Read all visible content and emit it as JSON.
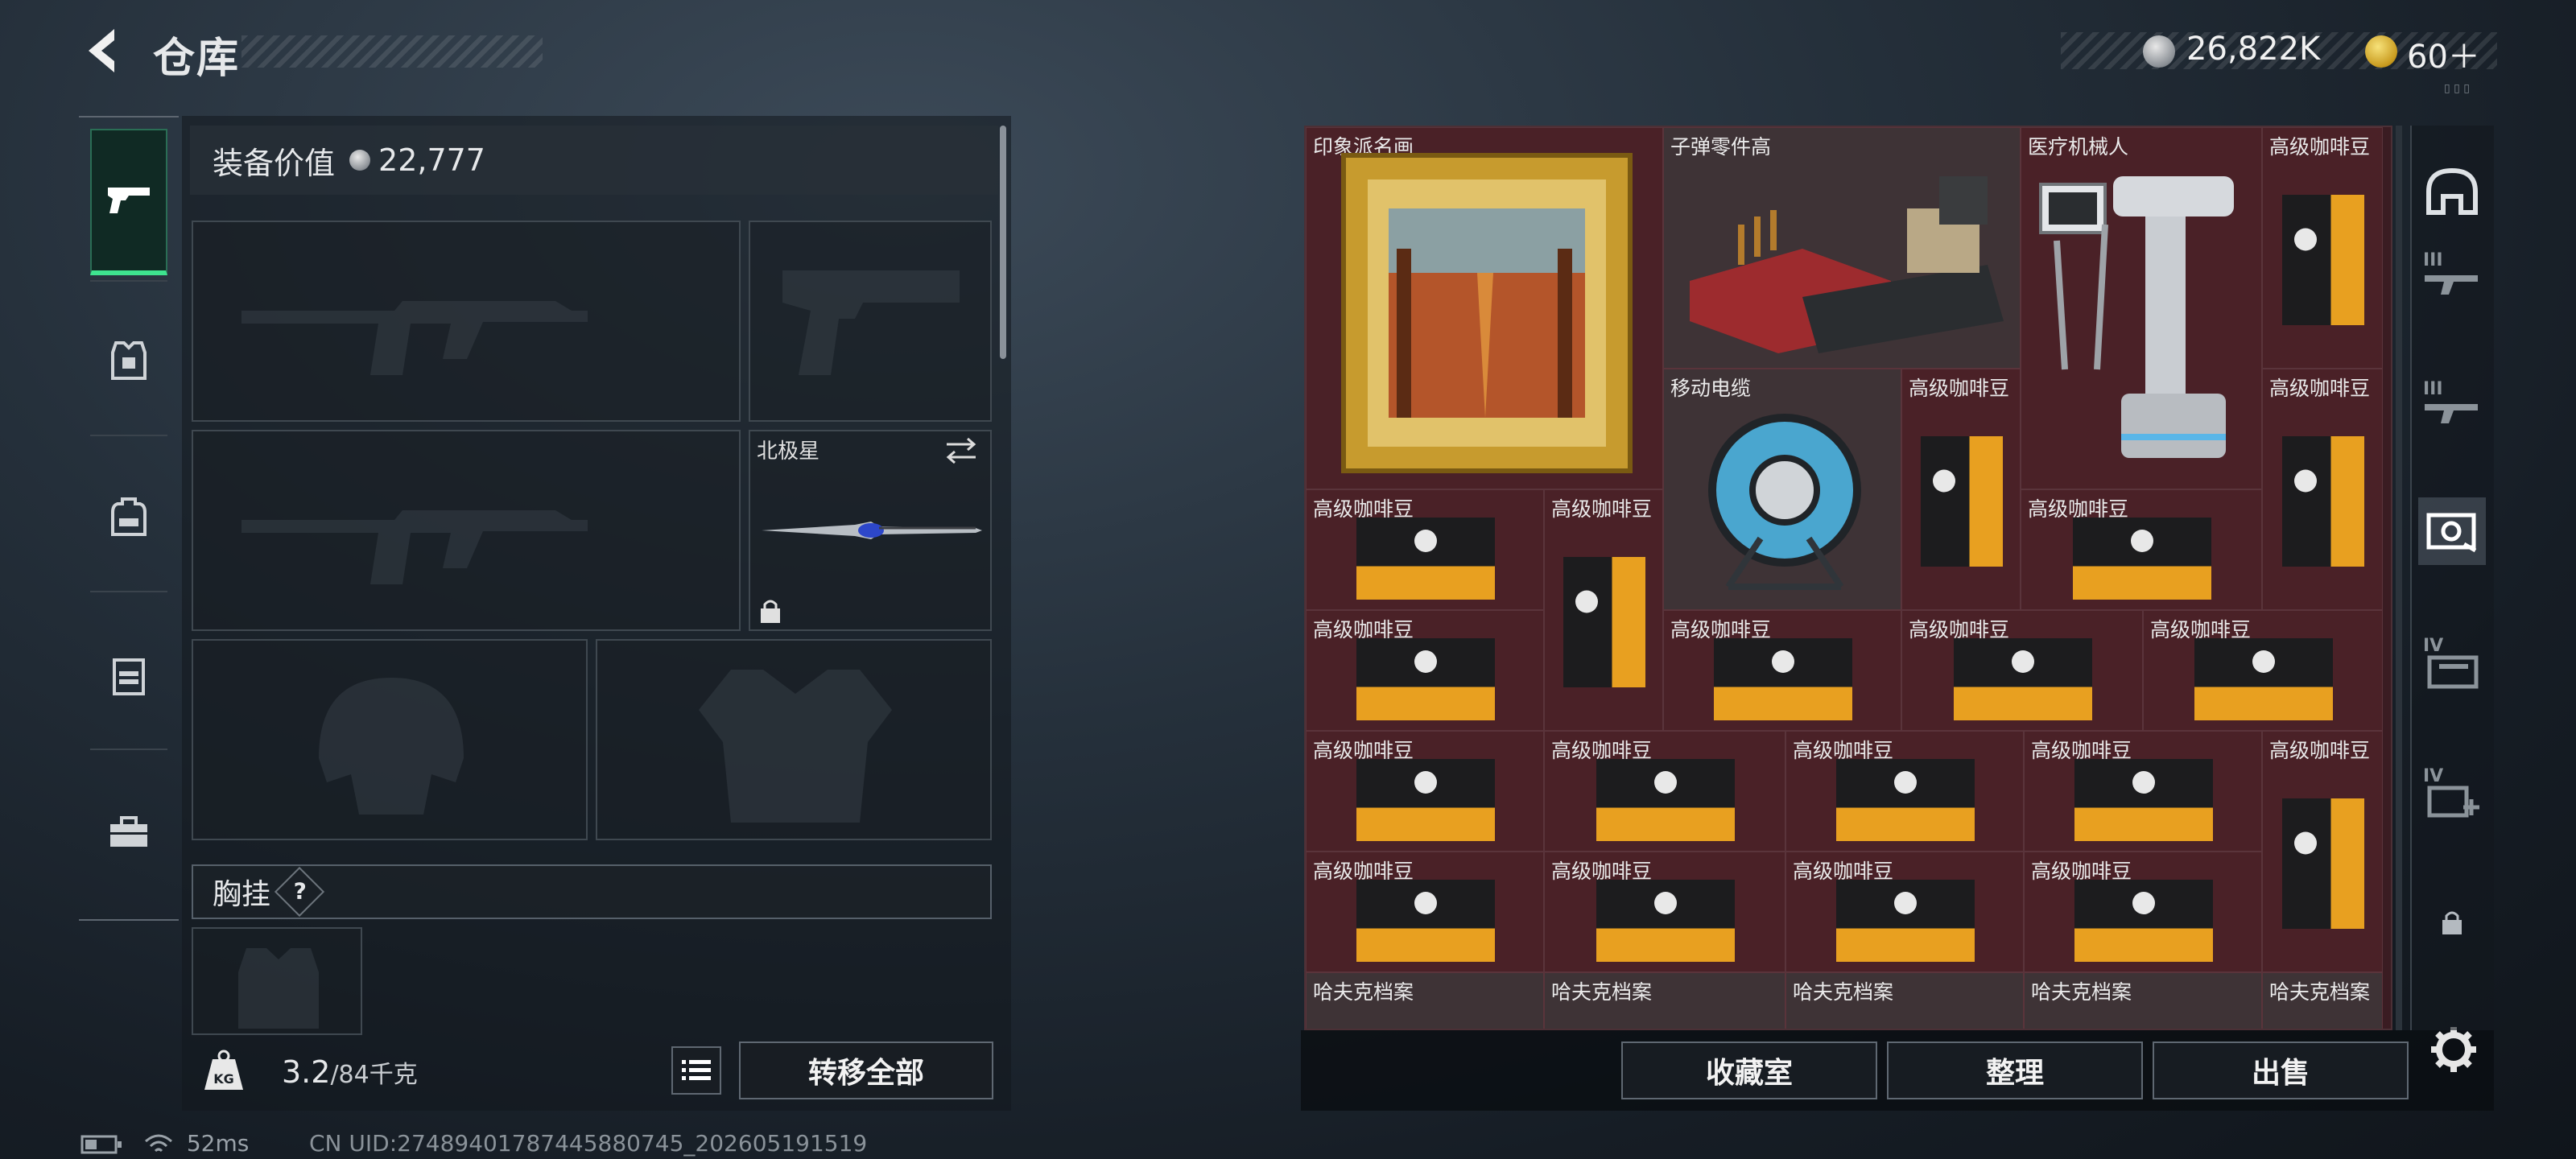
{
  "header": {
    "title": "仓库",
    "back_icon": "back-arrow-icon"
  },
  "currency": {
    "silver": "26,822K",
    "gold": "60＋"
  },
  "sidebar": {
    "items": [
      {
        "name": "pistol-icon",
        "active": true
      },
      {
        "name": "armor-vest-icon",
        "active": false
      },
      {
        "name": "backpack-icon",
        "active": false
      },
      {
        "name": "chest-rig-icon",
        "active": false
      },
      {
        "name": "toolbox-icon",
        "active": false
      }
    ]
  },
  "equipment": {
    "value_label": "装备价值",
    "value": "22,777",
    "melee_name": "北极星",
    "chest_label": "胸挂",
    "chest_help": "?",
    "weight": "3.2",
    "weight_capacity": "/84千克",
    "transfer_all": "转移全部"
  },
  "stash": {
    "items": [
      {
        "label": "印象派名画"
      },
      {
        "label": "子弹零件高"
      },
      {
        "label": "医疗机械人"
      },
      {
        "label": "高级咖啡豆"
      },
      {
        "label": "移动电缆"
      },
      {
        "label": "高级咖啡豆"
      },
      {
        "label": "高级咖啡豆"
      },
      {
        "label": "高级咖啡豆"
      },
      {
        "label": "高级咖啡豆"
      },
      {
        "label": "高级咖啡豆"
      },
      {
        "label": "高级咖啡豆"
      },
      {
        "label": "高级咖啡豆"
      },
      {
        "label": "高级咖啡豆"
      },
      {
        "label": "高级咖啡豆"
      },
      {
        "label": "高级咖啡豆"
      },
      {
        "label": "高级咖啡豆"
      },
      {
        "label": "高级咖啡豆"
      },
      {
        "label": "高级咖啡豆"
      },
      {
        "label": "高级咖啡豆"
      },
      {
        "label": "高级咖啡豆"
      },
      {
        "label": "高级咖啡豆"
      },
      {
        "label": "高级咖啡豆"
      },
      {
        "label": "高级咖啡豆"
      },
      {
        "label": "哈夫克档案"
      },
      {
        "label": "哈夫克档案"
      },
      {
        "label": "哈夫克档案"
      },
      {
        "label": "哈夫克档案"
      },
      {
        "label": "哈夫克档案"
      }
    ],
    "buttons": {
      "collection": "收藏室",
      "sort": "整理",
      "sell": "出售"
    }
  },
  "categories": [
    {
      "name": "helmet-category-icon",
      "tier": ""
    },
    {
      "name": "rifle-tier3-icon",
      "tier": "III"
    },
    {
      "name": "rifle-tier3-icon",
      "tier": "III"
    },
    {
      "name": "collectibles-icon",
      "tier": ""
    },
    {
      "name": "folder-tier4-icon",
      "tier": "IV"
    },
    {
      "name": "medkit-tier4-icon",
      "tier": "IV"
    },
    {
      "name": "lock-icon",
      "tier": ""
    }
  ],
  "status": {
    "ping": "52ms",
    "uid": "CN UID:274894017874458807​45_202605191519"
  },
  "colors": {
    "accent": "#3ee38f",
    "stash_bg": "#4a2127",
    "gold_bag": "#e8a020"
  }
}
